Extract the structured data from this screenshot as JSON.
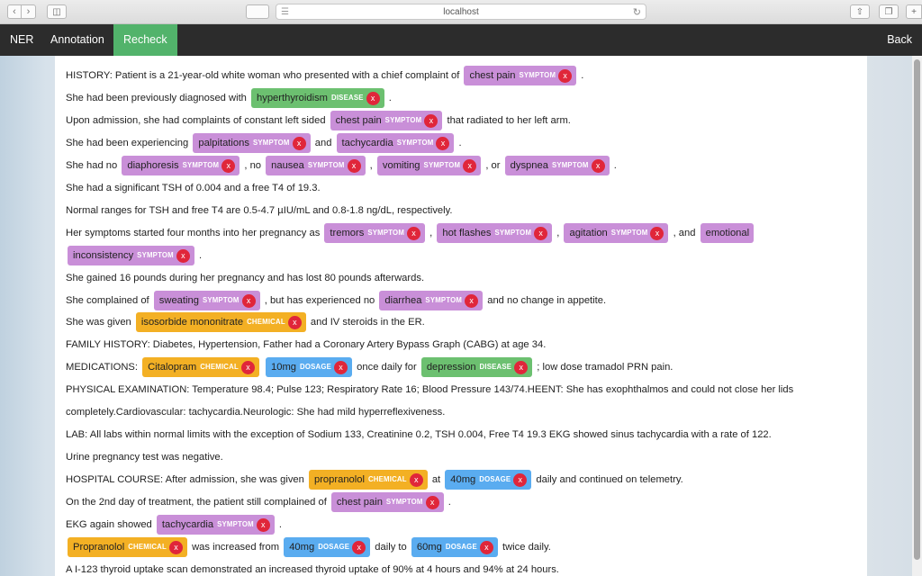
{
  "browser": {
    "url": "localhost",
    "back_icon": "chevron-left-icon",
    "forward_icon": "chevron-right-icon"
  },
  "nav": {
    "items": [
      {
        "label": "NER",
        "active": false
      },
      {
        "label": "Annotation",
        "active": false
      },
      {
        "label": "Recheck",
        "active": true
      }
    ],
    "back_label": "Back",
    "active_color": "#52b36b"
  },
  "entity_colors": {
    "SYMPTOM": "#c98fd8",
    "DISEASE": "#6cc070",
    "CHEMICAL": "#f3b024",
    "DOSAGE": "#5aacf0"
  },
  "remove_glyph": "x",
  "lines": [
    [
      {
        "t": "HISTORY: Patient is a 21-year-old white woman who presented with a chief complaint of "
      },
      {
        "e": "chest pain",
        "l": "SYMPTOM"
      },
      {
        "t": " ."
      }
    ],
    [
      {
        "t": "She had been previously diagnosed with "
      },
      {
        "e": "hyperthyroidism",
        "l": "DISEASE"
      },
      {
        "t": " ."
      }
    ],
    [
      {
        "t": "Upon admission, she had complaints of constant left sided "
      },
      {
        "e": "chest pain",
        "l": "SYMPTOM"
      },
      {
        "t": " that radiated to her left arm."
      }
    ],
    [
      {
        "t": "She had been experiencing "
      },
      {
        "e": "palpitations",
        "l": "SYMPTOM"
      },
      {
        "t": " and "
      },
      {
        "e": "tachycardia",
        "l": "SYMPTOM"
      },
      {
        "t": " ."
      }
    ],
    [
      {
        "t": "She had no "
      },
      {
        "e": "diaphoresis",
        "l": "SYMPTOM"
      },
      {
        "t": " , no "
      },
      {
        "e": "nausea",
        "l": "SYMPTOM"
      },
      {
        "t": " , "
      },
      {
        "e": "vomiting",
        "l": "SYMPTOM"
      },
      {
        "t": " , or "
      },
      {
        "e": "dyspnea",
        "l": "SYMPTOM"
      },
      {
        "t": " ."
      }
    ],
    [
      {
        "t": "She had a significant TSH of 0.004 and a free T4 of 19.3."
      }
    ],
    [
      {
        "t": "Normal ranges for TSH and free T4 are 0.5-4.7 µIU/mL and 0.8-1.8 ng/dL, respectively."
      }
    ],
    [
      {
        "t": "Her symptoms started four months into her pregnancy as "
      },
      {
        "e": "tremors",
        "l": "SYMPTOM"
      },
      {
        "t": " , "
      },
      {
        "e": "hot flashes",
        "l": "SYMPTOM"
      },
      {
        "t": " , "
      },
      {
        "e": "agitation",
        "l": "SYMPTOM"
      },
      {
        "t": " , and "
      },
      {
        "e": "emotional",
        "l": ""
      }
    ],
    [
      {
        "e": "inconsistency",
        "l": "SYMPTOM"
      },
      {
        "t": " ."
      }
    ],
    [
      {
        "t": "She gained 16 pounds during her pregnancy and has lost 80 pounds afterwards."
      }
    ],
    [
      {
        "t": "She complained of "
      },
      {
        "e": "sweating",
        "l": "SYMPTOM"
      },
      {
        "t": " , but has experienced no "
      },
      {
        "e": "diarrhea",
        "l": "SYMPTOM"
      },
      {
        "t": " and no change in appetite."
      }
    ],
    [
      {
        "t": "She was given "
      },
      {
        "e": "isosorbide mononitrate",
        "l": "CHEMICAL"
      },
      {
        "t": " and IV steroids in the ER."
      }
    ],
    [
      {
        "t": "FAMILY HISTORY: Diabetes, Hypertension, Father had a Coronary Artery Bypass Graph (CABG) at age 34."
      }
    ],
    [
      {
        "t": "MEDICATIONS: "
      },
      {
        "e": "Citalopram",
        "l": "CHEMICAL"
      },
      {
        "t": " "
      },
      {
        "e": "10mg",
        "l": "DOSAGE"
      },
      {
        "t": " once daily for "
      },
      {
        "e": "depression",
        "l": "DISEASE"
      },
      {
        "t": " ; low dose tramadol PRN pain."
      }
    ],
    [
      {
        "t": "PHYSICAL EXAMINATION: Temperature 98.4; Pulse 123; Respiratory Rate 16; Blood Pressure 143/74.HEENT: She has exophthalmos and could not close her lids"
      }
    ],
    [
      {
        "t": "completely.Cardiovascular: tachycardia.Neurologic: She had mild hyperreflexiveness."
      }
    ],
    [
      {
        "t": "LAB: All labs within normal limits with the exception of Sodium 133, Creatinine 0.2, TSH 0.004, Free T4 19.3 EKG showed sinus tachycardia with a rate of 122."
      }
    ],
    [
      {
        "t": "Urine pregnancy test was negative."
      }
    ],
    [
      {
        "t": "HOSPITAL COURSE: After admission, she was given "
      },
      {
        "e": "propranolol",
        "l": "CHEMICAL"
      },
      {
        "t": " at "
      },
      {
        "e": "40mg",
        "l": "DOSAGE"
      },
      {
        "t": " daily and continued on telemetry."
      }
    ],
    [
      {
        "t": "On the 2nd day of treatment, the patient still complained of "
      },
      {
        "e": "chest pain",
        "l": "SYMPTOM"
      },
      {
        "t": " ."
      }
    ],
    [
      {
        "t": "EKG again showed "
      },
      {
        "e": "tachycardia",
        "l": "SYMPTOM"
      },
      {
        "t": " ."
      }
    ],
    [
      {
        "e": "Propranolol",
        "l": "CHEMICAL"
      },
      {
        "t": " was increased from "
      },
      {
        "e": "40mg",
        "l": "DOSAGE"
      },
      {
        "t": " daily to "
      },
      {
        "e": "60mg",
        "l": "DOSAGE"
      },
      {
        "t": " twice daily."
      }
    ],
    [
      {
        "t": "A I-123 thyroid uptake scan demonstrated an increased thyroid uptake of 90% at 4 hours and 94% at 24 hours."
      }
    ]
  ]
}
